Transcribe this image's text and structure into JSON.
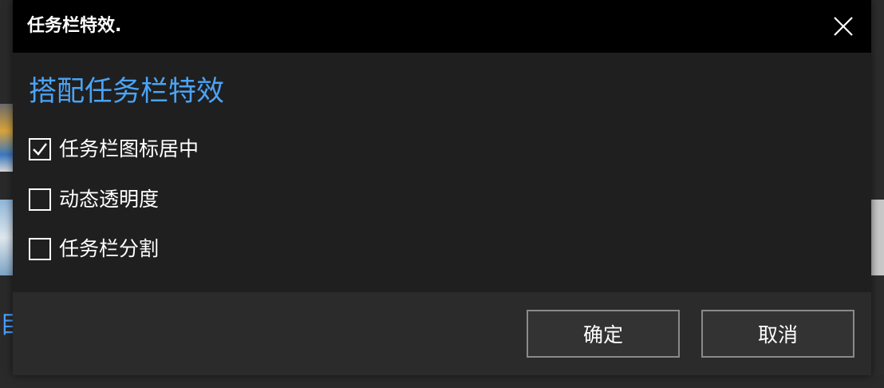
{
  "dialog": {
    "title": "任务栏特效.",
    "heading": "搭配任务栏特效",
    "options": [
      {
        "label": "任务栏图标居中",
        "checked": true
      },
      {
        "label": "动态透明度",
        "checked": false
      },
      {
        "label": "任务栏分割",
        "checked": false
      }
    ],
    "ok_label": "确定",
    "cancel_label": "取消"
  },
  "colors": {
    "titlebar": "#000000",
    "body": "#1f1f1f",
    "footer": "#2b2b2b",
    "heading": "#4ba3f5",
    "button_border": "#8a8a8a"
  },
  "icons": {
    "close": "close-icon",
    "check": "checkmark-icon"
  }
}
